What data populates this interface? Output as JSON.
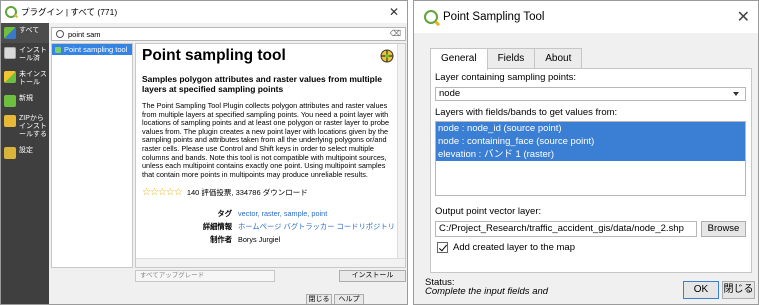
{
  "plugin_manager": {
    "title": "プラグイン | すべて (771)",
    "nav": [
      {
        "label": "すべて",
        "icon": "all-plugins-icon"
      },
      {
        "label": "インストール済",
        "icon": "installed-icon"
      },
      {
        "label": "未インストール",
        "icon": "not-installed-icon"
      },
      {
        "label": "新規",
        "icon": "new-icon"
      },
      {
        "label": "ZIPからインストールする",
        "icon": "zip-install-icon"
      },
      {
        "label": "設定",
        "icon": "settings-icon"
      }
    ],
    "search": {
      "value": "point sam"
    },
    "list": [
      "Point sampling tool"
    ],
    "detail": {
      "title": "Point sampling tool",
      "summary": "Samples polygon attributes and raster values from multiple layers at specified sampling points",
      "description": "The Point Sampling Tool Plugin collects polygon attributes and raster values from multiple layers at specified sampling points. You need a point layer with locations of sampling points and at least one polygon or raster layer to probe values from. The plugin creates a new point layer with locations given by the sampling points and attributes taken from all the underlying polygons or/and raster cells. Please use Control and Shift keys in order to select multiple columns and bands. Note this tool is not compatible with multipoint sources, unless each multipoint contains exactly one point. Using multipoint samples that contain more points in multipoints may produce unreliable results.",
      "stars": "☆☆☆☆☆",
      "rating_text": "140 評価投票, 334786 ダウンロード",
      "tags_label": "タグ",
      "tags": "vector, raster, sample, point",
      "more_info_label": "詳細情報",
      "more_info": "ホームページ  バグトラッカー  コードリポジトリ",
      "author_label": "制作者",
      "author": "Borys Jurgiel"
    },
    "upgrade_all": "すべてアップグレード",
    "install": "インストール",
    "close": "閉じる",
    "help": "ヘルプ"
  },
  "pst": {
    "title": "Point Sampling Tool",
    "tabs": [
      "General",
      "Fields",
      "About"
    ],
    "layer_label": "Layer containing sampling points:",
    "layer_value": "node",
    "fields_label": "Layers with fields/bands to get values from:",
    "fields": [
      "node : node_id (source point)",
      "node : containing_face (source point)",
      "elevation : バンド 1 (raster)"
    ],
    "output_label": "Output point vector layer:",
    "output_path": "C:/Project_Research/traffic_accident_gis/data/node_2.shp",
    "browse": "Browse",
    "add_layer": "Add created layer to the map",
    "status_label": "Status:",
    "status_text": "Complete the input fields and",
    "ok": "OK",
    "close": "閉じる"
  }
}
